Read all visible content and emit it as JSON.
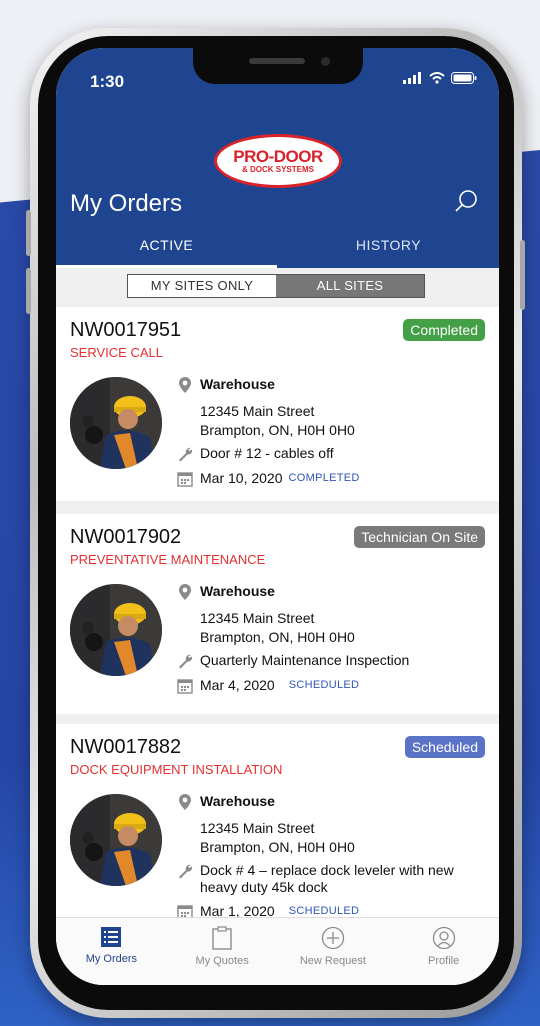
{
  "status_bar": {
    "time": "1:30"
  },
  "brand": {
    "logo_main": "PRO-DOOR",
    "logo_sub": "& DOCK SYSTEMS"
  },
  "header": {
    "title": "My Orders"
  },
  "tabs": [
    {
      "label": "ACTIVE",
      "active": true
    },
    {
      "label": "HISTORY",
      "active": false
    }
  ],
  "filter": {
    "options": [
      "MY SITES ONLY",
      "ALL SITES"
    ],
    "selected": "ALL SITES"
  },
  "orders": [
    {
      "id": "NW0017951",
      "type": "SERVICE CALL",
      "badge": "Completed",
      "badge_color": "#43a047",
      "site": "Warehouse",
      "address_line1": "12345 Main Street",
      "address_line2": "Brampton,  ON, H0H 0H0",
      "description": "Door # 12 - cables off",
      "date": "Mar 10, 2020",
      "status": "COMPLETED"
    },
    {
      "id": "NW0017902",
      "type": "PREVENTATIVE MAINTENANCE",
      "badge": "Technician On Site",
      "badge_color": "#7a7a7a",
      "site": "Warehouse",
      "address_line1": "12345 Main Street",
      "address_line2": "Brampton,  ON, H0H 0H0",
      "description": "Quarterly Maintenance Inspection",
      "date": "Mar 4, 2020",
      "status": "SCHEDULED"
    },
    {
      "id": "NW0017882",
      "type": "DOCK EQUIPMENT INSTALLATION",
      "badge": "Scheduled",
      "badge_color": "#5b73c6",
      "site": "Warehouse",
      "address_line1": "12345 Main Street",
      "address_line2": "Brampton,  ON, H0H 0H0",
      "description": "Dock # 4 – replace dock leveler with new heavy duty 45k dock",
      "date": "Mar 1, 2020",
      "status": "SCHEDULED"
    }
  ],
  "bottom_nav": [
    {
      "label": "My Orders",
      "icon": "list-icon",
      "active": true
    },
    {
      "label": "My Quotes",
      "icon": "clipboard-icon",
      "active": false
    },
    {
      "label": "New Request",
      "icon": "plus-circle-icon",
      "active": false
    },
    {
      "label": "Profile",
      "icon": "user-icon",
      "active": false
    }
  ],
  "colors": {
    "header_bg": "#1f4590",
    "accent_red": "#e53030",
    "status_blue": "#2f55b8"
  }
}
